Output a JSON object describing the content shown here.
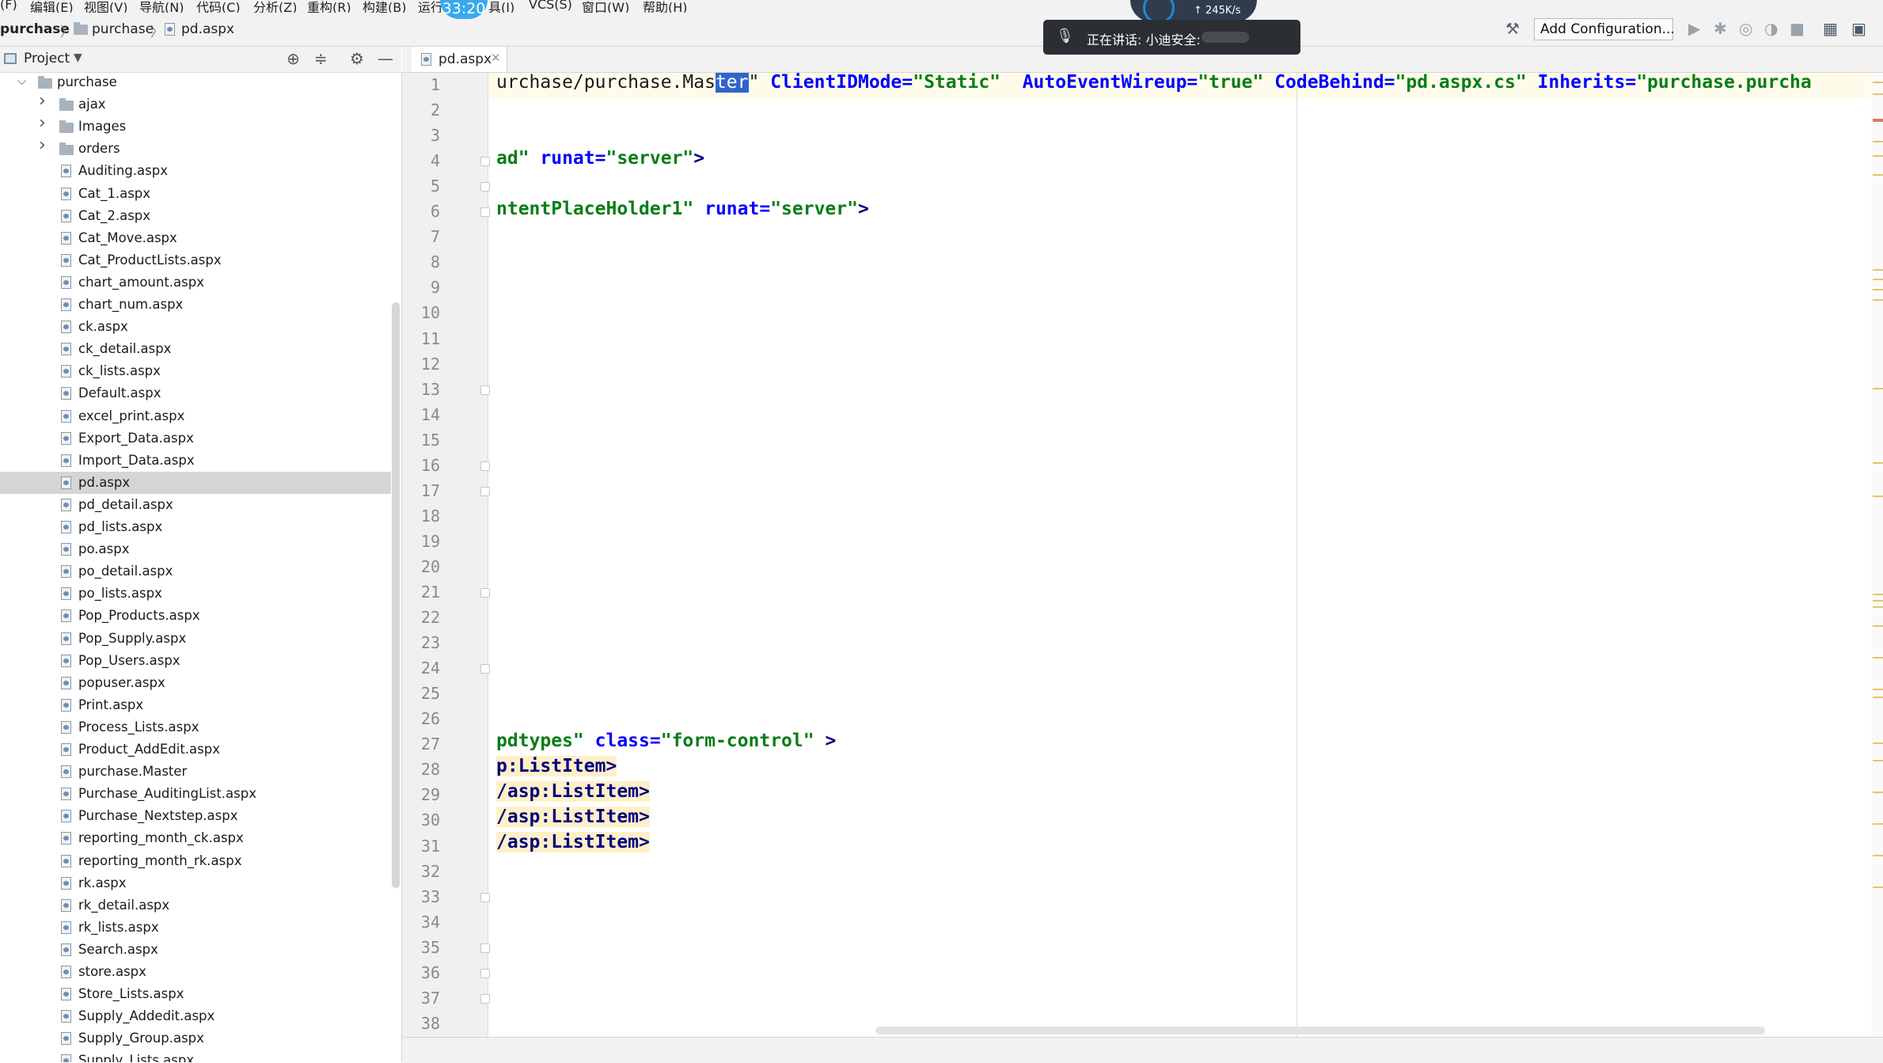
{
  "menu": {
    "items": [
      "(F)",
      "编辑(E)",
      "视图(V)",
      "导航(N)",
      "代码(C)",
      "分析(Z)",
      "重构(R)",
      "构建(B)",
      "运行",
      "具(I)",
      "VCS(S)",
      "窗口(W)",
      "帮助(H)"
    ]
  },
  "recording": {
    "time": "33:20"
  },
  "network": {
    "speed": "↑ 245K/s"
  },
  "speaking": {
    "text": "正在讲话: 小迪安全:"
  },
  "breadcrumb": {
    "project": "purchase",
    "folder": "purchase",
    "file": "pd.aspx"
  },
  "toolbar": {
    "add_configuration": "Add Configuration..."
  },
  "project_panel": {
    "title": "Project"
  },
  "tree": {
    "root": "purchase",
    "folders": [
      "ajax",
      "Images",
      "orders"
    ],
    "files": [
      "Auditing.aspx",
      "Cat_1.aspx",
      "Cat_2.aspx",
      "Cat_Move.aspx",
      "Cat_ProductLists.aspx",
      "chart_amount.aspx",
      "chart_num.aspx",
      "ck.aspx",
      "ck_detail.aspx",
      "ck_lists.aspx",
      "Default.aspx",
      "excel_print.aspx",
      "Export_Data.aspx",
      "Import_Data.aspx",
      "pd.aspx",
      "pd_detail.aspx",
      "pd_lists.aspx",
      "po.aspx",
      "po_detail.aspx",
      "po_lists.aspx",
      "Pop_Products.aspx",
      "Pop_Supply.aspx",
      "Pop_Users.aspx",
      "popuser.aspx",
      "Print.aspx",
      "Process_Lists.aspx",
      "Product_AddEdit.aspx",
      "purchase.Master",
      "Purchase_AuditingList.aspx",
      "Purchase_Nextstep.aspx",
      "reporting_month_ck.aspx",
      "reporting_month_rk.aspx",
      "rk.aspx",
      "rk_detail.aspx",
      "rk_lists.aspx",
      "Search.aspx",
      "store.aspx",
      "Store_Lists.aspx",
      "Supply_Addedit.aspx",
      "Supply_Group.aspx",
      "Supply_Lists.aspx"
    ],
    "selected": "pd.aspx"
  },
  "editor": {
    "tab": "pd.aspx",
    "line_numbers": [
      "1",
      "2",
      "3",
      "4",
      "5",
      "6",
      "7",
      "8",
      "9",
      "10",
      "11",
      "12",
      "13",
      "14",
      "15",
      "16",
      "17",
      "18",
      "19",
      "20",
      "21",
      "22",
      "23",
      "24",
      "25",
      "26",
      "27",
      "28",
      "29",
      "30",
      "31",
      "32",
      "33",
      "34",
      "35",
      "36",
      "37",
      "38"
    ],
    "code": {
      "l1": {
        "a": "urchase/purchase.Mas",
        "sel": "ter",
        "b": "\"",
        "attr1": " ClientIDMode=",
        "str1": "\"Static\"",
        "attr2": "  AutoEventWireup=",
        "str2": "\"true\"",
        "attr3": " CodeBehind=",
        "str3": "\"pd.aspx.cs\"",
        "attr4": " Inherits=",
        "str4": "\"purchase.purcha"
      },
      "l4": {
        "s1": "ad\"",
        "attr": " runat=",
        "str": "\"server\"",
        "end": ">"
      },
      "l6": {
        "s1": "ntentPlaceHolder1\"",
        "attr": " runat=",
        "str": "\"server\"",
        "end": ">"
      },
      "l27": {
        "s1": "pdtypes\"",
        "attr": " class=",
        "str": "\"form-control\"",
        "end": " >"
      },
      "l28": {
        "t": "p:ListItem>"
      },
      "l29": {
        "t": "/asp:ListItem>"
      },
      "l30": {
        "t": "/asp:ListItem>"
      },
      "l31": {
        "t": "/asp:ListItem>"
      }
    }
  }
}
